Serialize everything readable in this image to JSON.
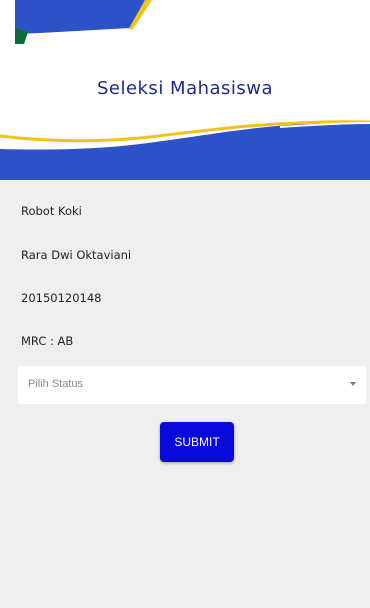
{
  "header": {
    "title": "Seleksi Mahasiswa"
  },
  "info": {
    "robot": "Robot Koki",
    "name": "Rara Dwi Oktaviani",
    "student_id": "20150120148",
    "mrc": "MRC : AB"
  },
  "status_select": {
    "selected": "Pilih Status"
  },
  "submit_label": "SUBMIT",
  "colors": {
    "primary_blue": "#2c52c8",
    "accent_yellow": "#f3c11c",
    "title_navy": "#1f2a8a",
    "button_blue": "#0909dc",
    "content_bg": "#efeff0"
  }
}
